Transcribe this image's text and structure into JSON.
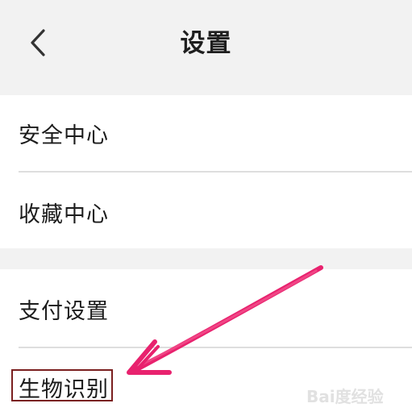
{
  "header": {
    "title": "设置",
    "back_icon": "chevron-left-icon"
  },
  "groups": [
    {
      "items": [
        {
          "label": "安全中心"
        },
        {
          "label": "收藏中心"
        }
      ]
    },
    {
      "items": [
        {
          "label": "支付设置"
        },
        {
          "label": "生物识别"
        }
      ]
    }
  ],
  "annotation": {
    "arrow_color": "#e8226e",
    "highlight_color": "#7a1f1f"
  },
  "watermark": {
    "text": "Bai度经验"
  },
  "colors": {
    "background": "#f2f2f2",
    "row": "#ffffff",
    "divider": "#dedede",
    "text": "#1c1c1c"
  }
}
